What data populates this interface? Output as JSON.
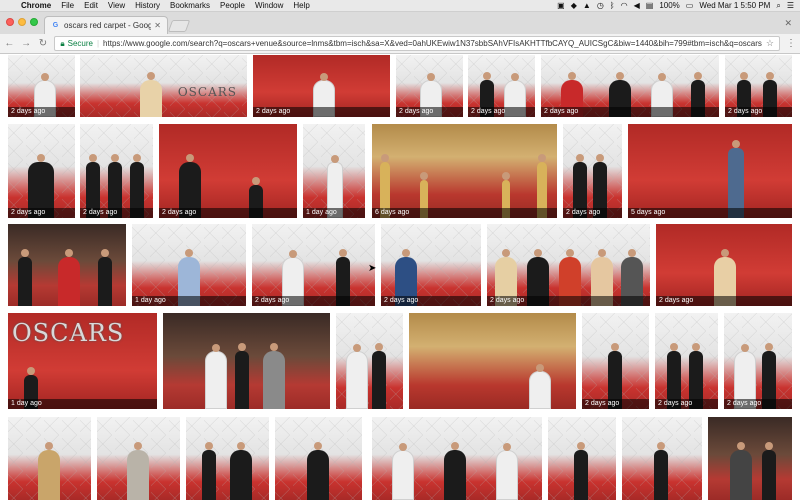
{
  "menubar": {
    "app": "Chrome",
    "items": [
      "File",
      "Edit",
      "View",
      "History",
      "Bookmarks",
      "People",
      "Window",
      "Help"
    ],
    "battery": "100%",
    "datetime": "Wed Mar 1  5:50 PM"
  },
  "tab": {
    "title": "oscars red carpet - Google Se",
    "favicon": "G"
  },
  "omnibox": {
    "secure_label": "Secure",
    "url": "https://www.google.com/search?q=oscars+venue&source=lnms&tbm=isch&sa=X&ved=0ahUKEwiw1N37sbbSAhVFIsAKHTTfbCAYQ_AUICSgC&biw=1440&bih=799#tbm=isch&q=oscars"
  },
  "thumbnails": [
    {
      "caption": "2 days ago"
    },
    {
      "caption": ""
    },
    {
      "caption": "2 days ago"
    },
    {
      "caption": "2 days ago"
    },
    {
      "caption": "2 days ago"
    },
    {
      "caption": "2 days ago"
    },
    {
      "caption": "2 days ago"
    },
    {
      "caption": "2 days ago"
    },
    {
      "caption": "2 days ago"
    },
    {
      "caption": "1 day ago"
    },
    {
      "caption": "6 days ago"
    },
    {
      "caption": "2 days ago"
    },
    {
      "caption": "5 days ago"
    },
    {
      "caption": "2 days ago"
    },
    {
      "caption": "1 day ago"
    },
    {
      "caption": "2 days ago"
    },
    {
      "caption": "2 days ago"
    },
    {
      "caption": "2 days ago"
    },
    {
      "caption": "2 days ago"
    },
    {
      "caption": "1 day ago",
      "logo": "OSCARS"
    },
    {
      "caption": ""
    },
    {
      "caption": ""
    },
    {
      "caption": ""
    },
    {
      "caption": "2 days ago"
    },
    {
      "caption": "2 days ago"
    },
    {
      "caption": "2 days ago"
    },
    {
      "caption": "2 days ago"
    },
    {
      "caption": ""
    },
    {
      "caption": ""
    },
    {
      "caption": ""
    },
    {
      "caption": ""
    },
    {
      "caption": ""
    },
    {
      "caption": ""
    },
    {
      "caption": ""
    },
    {
      "caption": ""
    },
    {
      "caption": ""
    }
  ]
}
